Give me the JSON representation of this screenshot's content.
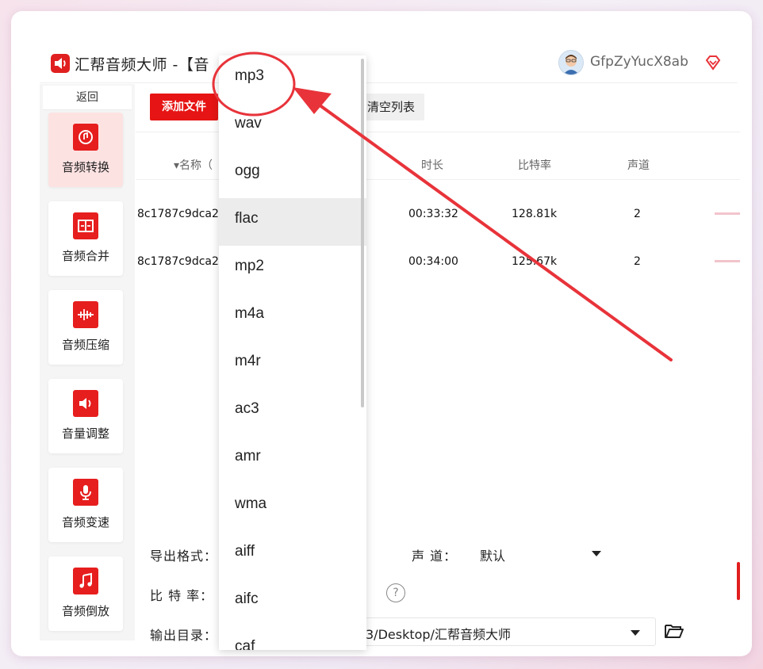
{
  "app": {
    "title": "汇帮音频大师  -【音",
    "user_name": "GfpZyYucX8ab"
  },
  "sidebar": {
    "back_label": "返回",
    "items": [
      {
        "label": "音频转换",
        "icon": "audio-convert-icon"
      },
      {
        "label": "音频合并",
        "icon": "audio-merge-icon"
      },
      {
        "label": "音频压缩",
        "icon": "audio-compress-icon"
      },
      {
        "label": "音量调整",
        "icon": "volume-adjust-icon"
      },
      {
        "label": "音频变速",
        "icon": "audio-speed-icon"
      },
      {
        "label": "音频倒放",
        "icon": "audio-reverse-icon"
      }
    ]
  },
  "toolbar": {
    "add_file_label": "添加文件",
    "clear_list_label": "清空列表"
  },
  "table": {
    "headers": {
      "name": "▾名称（",
      "duration": "时长",
      "bitrate": "比特率",
      "channels": "声道"
    },
    "rows": [
      {
        "name": "8c1787c9dca2",
        "duration": "00:33:32",
        "bitrate": "128.81k",
        "channels": "2"
      },
      {
        "name": "8c1787c9dca2",
        "duration": "00:34:00",
        "bitrate": "125.67k",
        "channels": "2"
      }
    ]
  },
  "settings": {
    "export_format_label": "导出格式：",
    "channel_label": "声 道：",
    "channel_value": "默认",
    "bitrate_label": "比 特 率：",
    "output_dir_label": "输出目录：",
    "output_dir_value": "3/Desktop/汇帮音频大师"
  },
  "dropdown": {
    "options": [
      "mp3",
      "wav",
      "ogg",
      "flac",
      "mp2",
      "m4a",
      "m4r",
      "ac3",
      "amr",
      "wma",
      "aiff",
      "aifc",
      "caf"
    ],
    "highlighted": "flac"
  },
  "colors": {
    "accent": "#e61414",
    "annotation": "#e8333a",
    "sidebar_active": "#fde2e2"
  }
}
